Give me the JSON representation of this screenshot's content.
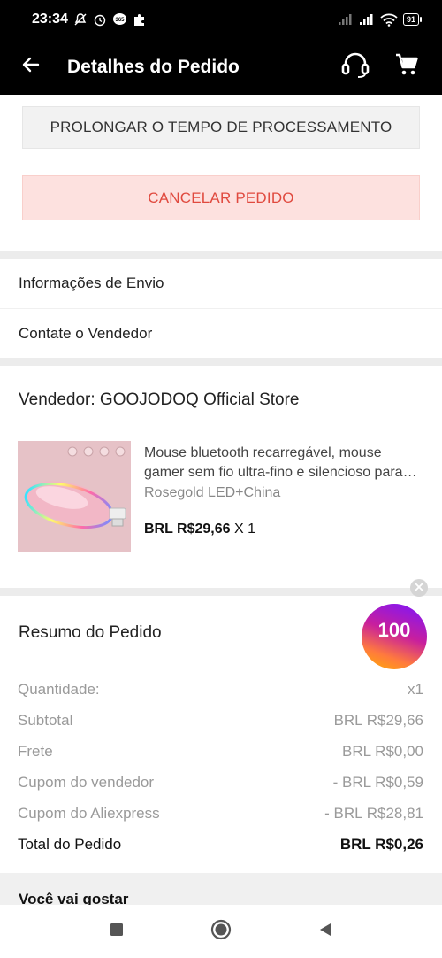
{
  "status_bar": {
    "time": "23:34",
    "battery": "91",
    "icons": [
      "mute-icon",
      "alarm-icon",
      "chat-icon",
      "puzzle-icon",
      "signal-icon",
      "signal-icon",
      "wifi-icon",
      "battery-icon"
    ]
  },
  "app_bar": {
    "title": "Detalhes do Pedido",
    "icons": [
      "back-arrow-icon",
      "headset-icon",
      "cart-icon"
    ]
  },
  "actions": {
    "prolong_label": "PROLONGAR O TEMPO DE PROCESSAMENTO",
    "cancel_label": "CANCELAR PEDIDO"
  },
  "info_rows": [
    {
      "label": "Informações de Envio"
    },
    {
      "label": "Contate o Vendedor"
    }
  ],
  "seller": {
    "name": "Vendedor: GOOJODOQ Official Store"
  },
  "product": {
    "title": "Mouse bluetooth recarregável, mouse gamer sem fio ultra-fino e silencioso para computador",
    "variant": "Rosegold LED+China",
    "price": "BRL R$29,66",
    "quantity": "X 1"
  },
  "promo": {
    "coin_value": "100"
  },
  "summary": {
    "heading": "Resumo do Pedido",
    "rows": [
      {
        "label": "Quantidade:",
        "value": "x1"
      },
      {
        "label": "Subtotal",
        "value": "BRL R$29,66"
      },
      {
        "label": "Frete",
        "value": "BRL R$0,00"
      },
      {
        "label": "Cupom do vendedor",
        "value": "- BRL R$0,59"
      },
      {
        "label": "Cupom do Aliexpress",
        "value": "- BRL R$28,81"
      }
    ],
    "total_label": "Total do Pedido",
    "total_value": "BRL R$0,26"
  },
  "suggestions": {
    "title": "Você vai gostar"
  },
  "colors": {
    "cancel_text": "#e04a3f",
    "cancel_bg": "#fde1df",
    "header_bg": "#000000"
  }
}
